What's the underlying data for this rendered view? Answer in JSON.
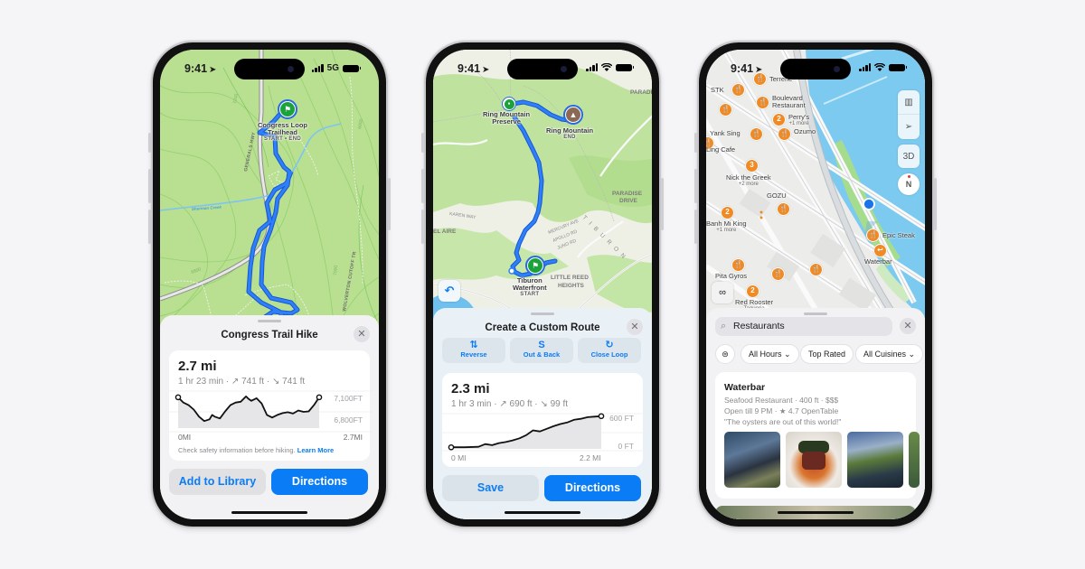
{
  "page": {
    "background": "#f5f5f7",
    "accent": "#0a7cf5"
  },
  "phones": [
    {
      "status": {
        "time": "9:41",
        "carrier": "5G"
      },
      "map": {
        "trailhead": {
          "name": "Congress Loop\nTrailhead",
          "line1": "Congress Loop",
          "line2": "Trailhead",
          "sub": "START • END"
        },
        "labels": {
          "road": "GENERALS HWY",
          "creek": "Sherman Creek",
          "cutoff": "WOLVERTON CUTOFF TR",
          "alta": "ALTA TRAIL",
          "contour1": "6900",
          "contour2": "7000",
          "contour3": "7200",
          "contour4": "6800"
        },
        "colors": {
          "land": "#b8e08e",
          "route": "#1f6ef0",
          "water": "#7cc4f2"
        }
      },
      "sheet": {
        "title": "Congress Trail Hike",
        "distance": "2.7 mi",
        "stats": "1 hr 23 min · ↗ 741 ft · ↘ 741 ft",
        "note": "Check safety information before hiking.",
        "learn_more": "Learn More",
        "secondary_button": "Add to Library",
        "primary_button": "Directions"
      },
      "chart_data": {
        "type": "line",
        "title": "Elevation profile",
        "xlabel": "Distance",
        "ylabel": "Elevation",
        "x_start_label": "0MI",
        "x_end_label": "2.7MI",
        "y_tick_labels": [
          "7,100FT",
          "6,800FT"
        ],
        "xlim": [
          0,
          2.7
        ],
        "ylim": [
          6750,
          7150
        ],
        "x": [
          0,
          0.1,
          0.2,
          0.3,
          0.4,
          0.5,
          0.6,
          0.65,
          0.7,
          0.8,
          0.9,
          1.0,
          1.1,
          1.2,
          1.3,
          1.35,
          1.4,
          1.5,
          1.6,
          1.7,
          1.8,
          1.9,
          2.0,
          2.1,
          2.2,
          2.3,
          2.4,
          2.5,
          2.6,
          2.7
        ],
        "y": [
          7100,
          7040,
          7010,
          6960,
          6880,
          6830,
          6850,
          6900,
          6880,
          6860,
          6940,
          7010,
          7040,
          7050,
          7110,
          7080,
          7060,
          7090,
          7030,
          6900,
          6870,
          6900,
          6920,
          6930,
          6915,
          6950,
          6935,
          6940,
          7010,
          7100
        ]
      }
    },
    {
      "status": {
        "time": "9:41"
      },
      "map": {
        "preserve": {
          "line1": "Ring Mountain",
          "line2": "Preserve"
        },
        "mountain": {
          "name": "Ring Mountain",
          "sub": "END"
        },
        "waterfront": {
          "line1": "Tiburon",
          "line2": "Waterfront",
          "sub": "START"
        },
        "labels": {
          "paradise": "PARADISE",
          "paradise_drive1": "PARADISE",
          "paradise_drive2": "DRIVE",
          "karen": "KAREN WAY",
          "belaire": "EL AIRE",
          "mercury": "MERCURY AVE",
          "apollo": "APOLLO RD",
          "juno": "JUNO RD",
          "tiburon": "T I B U R O N",
          "reed1": "LITTLE REED",
          "reed2": "HEIGHTS"
        },
        "colors": {
          "land": "#eef0e8",
          "park": "#bfe3a0",
          "route": "#1f6ef0",
          "water": "#6ec0ef"
        }
      },
      "sheet": {
        "title": "Create a Custom Route",
        "segments": [
          {
            "icon": "⇅",
            "label": "Reverse"
          },
          {
            "icon": "S",
            "label": "Out & Back"
          },
          {
            "icon": "↻",
            "label": "Close Loop"
          }
        ],
        "distance": "2.3 mi",
        "stats": "1 hr 3 min · ↗ 690 ft · ↘ 99 ft",
        "secondary_button": "Save",
        "primary_button": "Directions"
      },
      "chart_data": {
        "type": "line",
        "title": "Elevation profile",
        "xlabel": "Distance",
        "ylabel": "Elevation",
        "x_start_label": "0 MI",
        "x_end_label": "2.2 MI",
        "y_tick_labels": [
          "600 FT",
          "0 FT"
        ],
        "xlim": [
          0,
          2.2
        ],
        "ylim": [
          -30,
          620
        ],
        "x": [
          0,
          0.2,
          0.4,
          0.5,
          0.6,
          0.7,
          0.8,
          0.9,
          1.0,
          1.1,
          1.2,
          1.3,
          1.4,
          1.5,
          1.6,
          1.7,
          1.8,
          1.9,
          2.0,
          2.1,
          2.2
        ],
        "y": [
          0,
          0,
          10,
          60,
          40,
          80,
          100,
          130,
          170,
          230,
          320,
          300,
          350,
          400,
          440,
          470,
          520,
          540,
          570,
          580,
          590
        ]
      }
    },
    {
      "status": {
        "time": "9:41"
      },
      "map": {
        "pois": [
          {
            "label": "Terrene",
            "count": ""
          },
          {
            "label": "STK",
            "count": ""
          },
          {
            "label": "Boulevard\nRestaurant",
            "line1": "Boulevard",
            "line2": "Restaurant",
            "count": ""
          },
          {
            "label": "Perry's",
            "sub": "+1 more",
            "count": "2"
          },
          {
            "label": "Ozumo",
            "count": ""
          },
          {
            "label": "Yank Sing",
            "count": ""
          },
          {
            "label": "Nick the Greek",
            "sub": "+2 more",
            "count": "3"
          },
          {
            "label": "GOZU",
            "count": ""
          },
          {
            "label": "Banh Mi King",
            "sub": "+1 more",
            "count": "2"
          },
          {
            "label": "Epic Steak",
            "count": ""
          },
          {
            "label": "Waterbar",
            "count": ""
          },
          {
            "label": "Pita Gyros",
            "count": ""
          },
          {
            "label": "Red Rooster",
            "sub": "Taqueria",
            "count": "2"
          },
          {
            "label": "Ling Cafe",
            "count": ""
          }
        ],
        "controls": {
          "map_mode": "map-icon",
          "locate": "location-arrow-icon",
          "view3d": "3D",
          "compass": "N"
        },
        "colors": {
          "land": "#eeeeec",
          "water": "#7ccaf0",
          "park": "#a6dc8e",
          "poi": "#f08a24",
          "user": "#1a73e8"
        }
      },
      "sheet": {
        "search_value": "Restaurants",
        "filters": [
          "All Hours",
          "Top Rated",
          "All Cuisines"
        ],
        "result": {
          "name": "Waterbar",
          "line1": "Seafood Restaurant · 400 ft · $$$",
          "line2": "Open till 9 PM · ★ 4.7 OpenTable",
          "quote": "\"The oysters are out of this world!\""
        }
      }
    }
  ]
}
